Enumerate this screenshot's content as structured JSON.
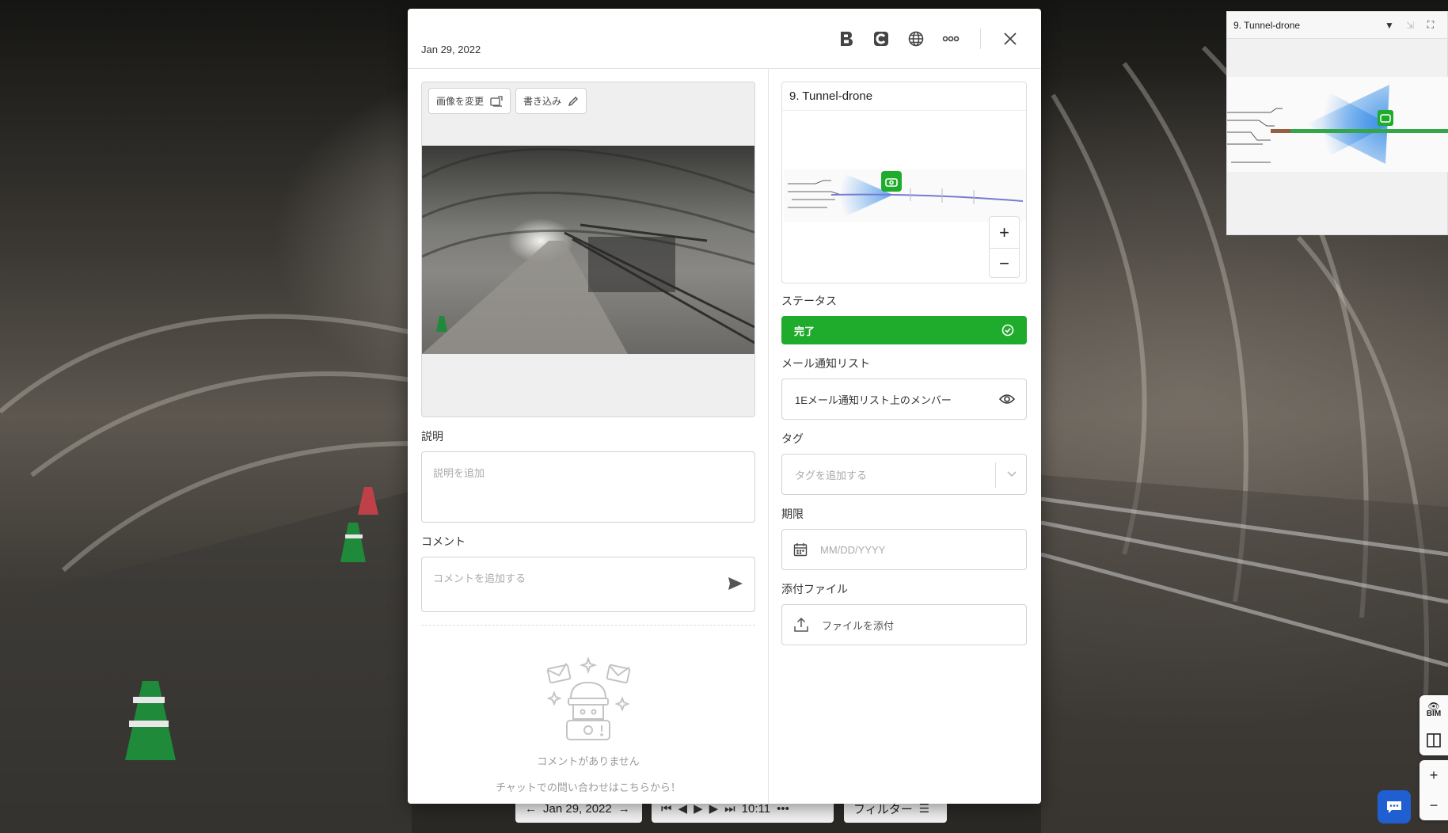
{
  "modal": {
    "date": "Jan 29, 2022",
    "toolbar": {
      "bim_icon": "bim-b-icon",
      "c_icon": "c-logo-icon",
      "globe_icon": "globe-icon",
      "more_icon": "more-dots-icon",
      "close_icon": "close-icon"
    },
    "image": {
      "change_label": "画像を変更",
      "annotate_label": "書き込み"
    },
    "description": {
      "label": "説明",
      "placeholder": "説明を追加",
      "value": ""
    },
    "comment": {
      "label": "コメント",
      "placeholder": "コメントを追加する",
      "value": "",
      "empty_title": "コメントがありません",
      "empty_sub": "チャットでの問い合わせはこちらから！"
    },
    "map": {
      "title": "9. Tunnel-drone",
      "zoom_in": "+",
      "zoom_out": "−"
    },
    "status": {
      "label": "ステータス",
      "value": "完了",
      "color": "#1fac2c"
    },
    "notify": {
      "label": "メール通知リスト",
      "value": "1Eメール通知リスト上のメンバー"
    },
    "tags": {
      "label": "タグ",
      "placeholder": "タグを追加する"
    },
    "due": {
      "label": "期限",
      "placeholder": "MM/DD/YYYY"
    },
    "attachments": {
      "label": "添付ファイル",
      "button": "ファイルを添付"
    }
  },
  "minimap": {
    "title": "9. Tunnel-drone"
  },
  "bottom_bar": {
    "date": "Jan 29, 2022",
    "time": "10:11",
    "filter": "フィルター"
  },
  "right_controls": {
    "bim_label": "BIM",
    "zoom_in": "+",
    "zoom_out": "−"
  },
  "colors": {
    "accent_green": "#1fac2c",
    "chat_blue": "#1f5fd1"
  }
}
